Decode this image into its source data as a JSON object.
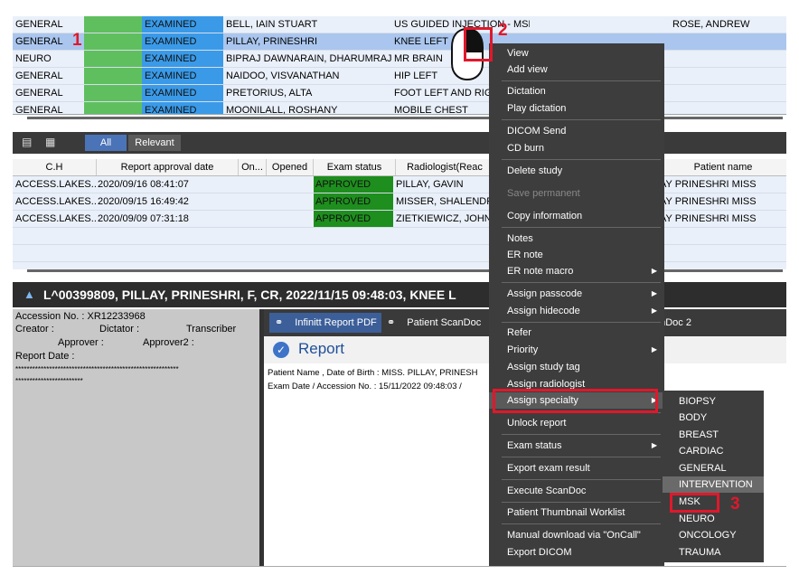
{
  "worklist": {
    "rows": [
      {
        "modality": "GENERAL",
        "status": "EXAMINED",
        "patient": "BELL, IAIN STUART",
        "exam": "US GUIDED INJECTION - MSK",
        "physician": "ROSE, ANDREW"
      },
      {
        "modality": "GENERAL",
        "status": "EXAMINED",
        "patient": "PILLAY, PRINESHRI",
        "exam": "KNEE LEFT",
        "physician": ""
      },
      {
        "modality": "NEURO",
        "status": "EXAMINED",
        "patient": "BIPRAJ DAWNARAIN, DHARUMRAJ",
        "exam": "MR BRAIN",
        "physician": ""
      },
      {
        "modality": "GENERAL",
        "status": "EXAMINED",
        "patient": "NAIDOO, VISVANATHAN",
        "exam": "HIP LEFT",
        "physician": ""
      },
      {
        "modality": "GENERAL",
        "status": "EXAMINED",
        "patient": "PRETORIUS, ALTA",
        "exam": "FOOT LEFT AND RIG",
        "physician": ""
      },
      {
        "modality": "GENERAL",
        "status": "EXAMINED",
        "patient": "MOONILALL, ROSHANY",
        "exam": "MOBILE CHEST",
        "physician": ""
      }
    ],
    "selected_index": 1
  },
  "toolbar": {
    "tab_all": "All",
    "tab_relevant": "Relevant",
    "icon1": "list-icon",
    "icon2": "grid-icon"
  },
  "history": {
    "headers": [
      "C.H",
      "Report approval date",
      "On...",
      "Opened",
      "Exam status",
      "Radiologist(Reac",
      "Patient name"
    ],
    "rows": [
      {
        "ch": "ACCESS.LAKES...",
        "date": "2020/09/16 08:41:07",
        "status": "APPROVED",
        "radiologist": "PILLAY, GAVIN",
        "patient": "AY PRINESHRI  MISS"
      },
      {
        "ch": "ACCESS.LAKES...",
        "date": "2020/09/15 16:49:42",
        "status": "APPROVED",
        "radiologist": "MISSER, SHALENDR",
        "patient": "AY PRINESHRI  MISS"
      },
      {
        "ch": "ACCESS.LAKES...",
        "date": "2020/09/09 07:31:18",
        "status": "APPROVED",
        "radiologist": "ZIETKIEWICZ, JOHN",
        "patient": "AY PRINESHRI  MISS"
      }
    ]
  },
  "patient_bar": {
    "text": "L^00399809, PILLAY, PRINESHRI, F, CR, 2022/11/15 09:48:03, KNEE L"
  },
  "info_panel": {
    "accession": "Accession No. : XR12233968",
    "creator": "Creator :",
    "dictator": "Dictator :",
    "transcriber": "Transcriber",
    "approver": "Approver :",
    "approver2": "Approver2 :",
    "report_date": "Report Date :",
    "stars1": "**********************************************************",
    "stars2": "************************"
  },
  "report": {
    "tab1": "Infinitt Report PDF",
    "tab2": "Patient ScanDoc",
    "tab3": "anDoc 2",
    "title": "Report",
    "line1": "Patient Name , Date of Birth : MISS. PILLAY, PRINESH",
    "line2": "Exam Date / Accession No.   : 15/11/2022 09:48:03 /"
  },
  "context_menu": {
    "items": [
      {
        "label": "View",
        "submenu": false,
        "disabled": false
      },
      {
        "label": "Add view",
        "submenu": false,
        "disabled": false
      },
      {
        "label": "Dictation",
        "submenu": false,
        "disabled": false
      },
      {
        "label": "Play dictation",
        "submenu": false,
        "disabled": false
      },
      {
        "label": "DICOM Send",
        "submenu": false,
        "disabled": false
      },
      {
        "label": "CD burn",
        "submenu": false,
        "disabled": false
      },
      {
        "label": "Delete study",
        "submenu": false,
        "disabled": false
      },
      {
        "label": "Save permanent",
        "submenu": false,
        "disabled": true
      },
      {
        "label": "Copy information",
        "submenu": false,
        "disabled": false
      },
      {
        "label": "Notes",
        "submenu": false,
        "disabled": false
      },
      {
        "label": "ER note",
        "submenu": false,
        "disabled": false
      },
      {
        "label": "ER note macro",
        "submenu": true,
        "disabled": false
      },
      {
        "label": "Assign passcode",
        "submenu": true,
        "disabled": false
      },
      {
        "label": "Assign hidecode",
        "submenu": true,
        "disabled": false
      },
      {
        "label": "Refer",
        "submenu": false,
        "disabled": false
      },
      {
        "label": "Priority",
        "submenu": true,
        "disabled": false
      },
      {
        "label": "Assign study tag",
        "submenu": false,
        "disabled": false
      },
      {
        "label": "Assign radiologist",
        "submenu": false,
        "disabled": false
      },
      {
        "label": "Assign specialty",
        "submenu": true,
        "disabled": false
      },
      {
        "label": "Unlock report",
        "submenu": false,
        "disabled": false
      },
      {
        "label": "Exam status",
        "submenu": true,
        "disabled": false
      },
      {
        "label": "Export exam result",
        "submenu": false,
        "disabled": false
      },
      {
        "label": "Execute ScanDoc",
        "submenu": false,
        "disabled": false
      },
      {
        "label": "Patient Thumbnail Worklist",
        "submenu": false,
        "disabled": false
      },
      {
        "label": "Manual download via \"OnCall\"",
        "submenu": false,
        "disabled": false
      },
      {
        "label": "Export DICOM",
        "submenu": false,
        "disabled": false
      }
    ],
    "highlighted": "Assign specialty"
  },
  "specialty_submenu": {
    "items": [
      "BIOPSY",
      "BODY",
      "BREAST",
      "CARDIAC",
      "GENERAL",
      "INTERVENTION",
      "MSK",
      "NEURO",
      "ONCOLOGY",
      "TRAUMA"
    ],
    "highlighted": "INTERVENTION"
  },
  "annotations": {
    "step1": "1",
    "step2": "2",
    "step3": "3",
    "color": "#e0182b"
  }
}
